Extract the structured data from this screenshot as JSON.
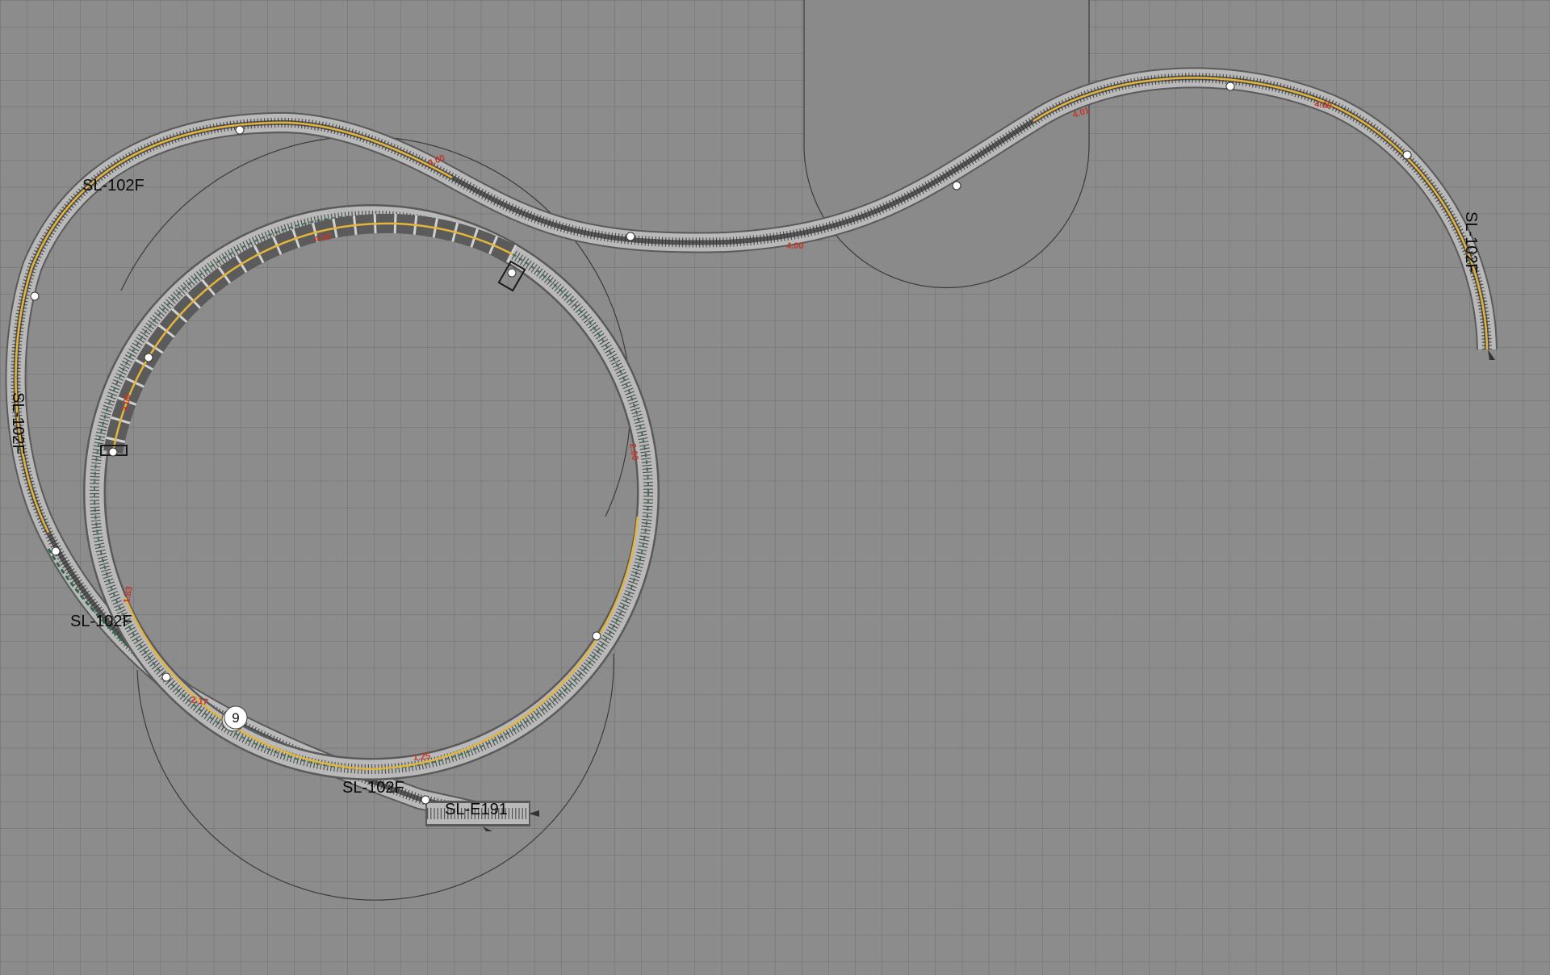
{
  "canvas": {
    "background": "#8c8c8c",
    "grid_color": "#6e6e6e"
  },
  "labels": {
    "top_left": "SL-102F",
    "left_vertical": "SL-102F",
    "right_vertical": "SL-102F",
    "lower_left": "SL-102F",
    "bottom": "SL-102F",
    "end_piece": "SL-E191"
  },
  "marker": {
    "number": "9"
  },
  "elevations": {
    "top_arc": "4.00",
    "s_curve_mid": "4.00",
    "s_curve_low": "4.01",
    "s_right_up": "4.01",
    "s_right_top": "4.00",
    "loop_top": "4.00",
    "loop_left": "3.00",
    "loop_right": "2.00",
    "loop_lower_left": "2.17",
    "loop_lower_inner": "1.83",
    "loop_bottom": "1.25"
  },
  "colors": {
    "track_bed": "#b9b9b9",
    "track_edge": "#5a5a5a",
    "rail": "#3a3a3a",
    "center_line": "#e3b53a",
    "viaduct_deck": "#5b5b5b",
    "slope_green": "#2f6b4a",
    "joint_dot": "#ffffff"
  }
}
